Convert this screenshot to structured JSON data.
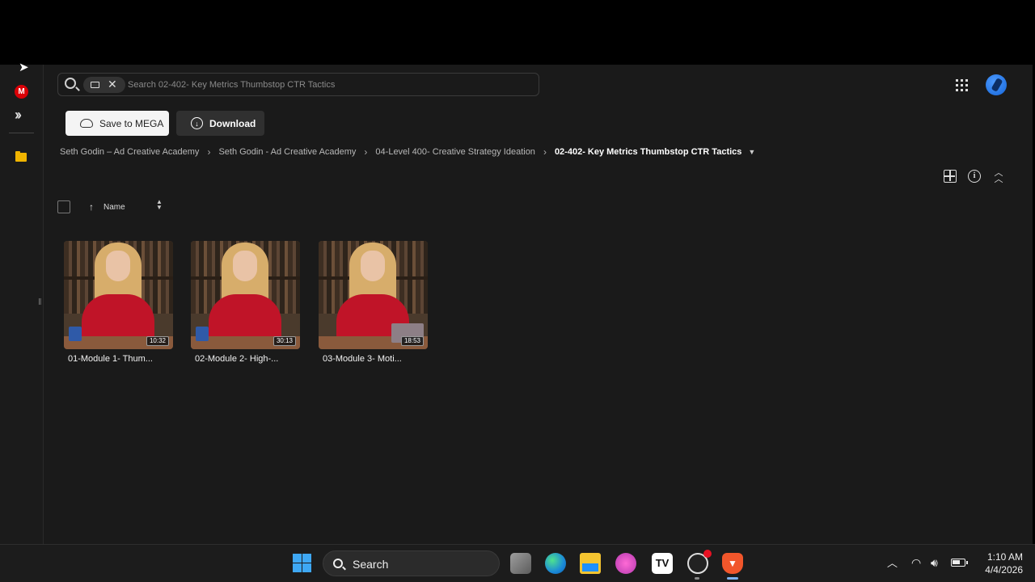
{
  "search": {
    "placeholder": "Search 02-402- Key Metrics Thumbstop CTR Tactics"
  },
  "toolbar": {
    "save_label": "Save to MEGA",
    "download_label": "Download"
  },
  "breadcrumb": [
    "Seth Godin – Ad Creative Academy",
    "Seth Godin - Ad Creative Academy",
    "04-Level 400- Creative Strategy Ideation",
    "02-402- Key Metrics Thumbstop CTR Tactics"
  ],
  "sort": {
    "label": "Name"
  },
  "files": [
    {
      "title": "01-Module 1- Thum...",
      "duration": "10:32"
    },
    {
      "title": "02-Module 2- High-...",
      "duration": "30:13"
    },
    {
      "title": "03-Module 3- Moti...",
      "duration": "18:53"
    }
  ],
  "taskbar": {
    "search_label": "Search",
    "time": "1:10 AM",
    "date": "4/4/2026"
  },
  "colors": {
    "background": "#1a1a1a",
    "mega_red": "#d90007",
    "accent_blue": "#1565d8"
  }
}
